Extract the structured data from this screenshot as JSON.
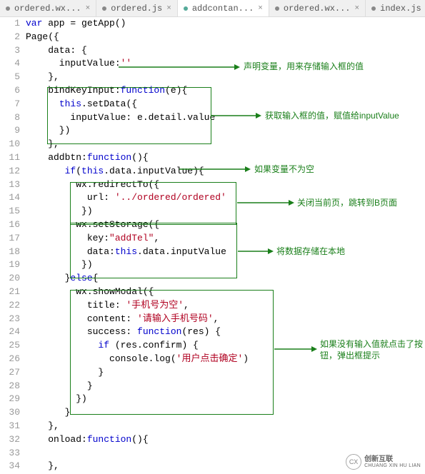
{
  "tabs": [
    {
      "label": "ordered.wx...",
      "active": false
    },
    {
      "label": "ordered.js",
      "active": false
    },
    {
      "label": "addcontan...",
      "active": true
    },
    {
      "label": "ordered.wx...",
      "active": false
    },
    {
      "label": "index.js",
      "active": false
    }
  ],
  "lines": [
    {
      "n": 1,
      "html": "<span class='kw'>var</span> app = getApp()"
    },
    {
      "n": 2,
      "html": "Page({"
    },
    {
      "n": 3,
      "html": "    data: {"
    },
    {
      "n": 4,
      "html": "      inputValue:<span class='str'>''</span>"
    },
    {
      "n": 5,
      "html": "    },"
    },
    {
      "n": 6,
      "html": "    bindKeyInput:<span class='kw'>function</span>(e){"
    },
    {
      "n": 7,
      "html": "      <span class='this'>this</span>.setData({"
    },
    {
      "n": 8,
      "html": "        inputValue: e.detail.value"
    },
    {
      "n": 9,
      "html": "      })"
    },
    {
      "n": 10,
      "html": "    },"
    },
    {
      "n": 11,
      "html": "    addbtn:<span class='kw'>function</span>(){"
    },
    {
      "n": 12,
      "html": "       <span class='kw'>if</span>(<span class='this'>this</span>.data.inputValue){"
    },
    {
      "n": 13,
      "html": "         wx.redirectTo({"
    },
    {
      "n": 14,
      "html": "           url: <span class='str'>'../ordered/ordered'</span>"
    },
    {
      "n": 15,
      "html": "          })"
    },
    {
      "n": 16,
      "html": "         wx.setStorage({"
    },
    {
      "n": 17,
      "html": "           key:<span class='str'>\"addTel\"</span>,"
    },
    {
      "n": 18,
      "html": "           data:<span class='this'>this</span>.data.inputValue"
    },
    {
      "n": 19,
      "html": "          })"
    },
    {
      "n": 20,
      "html": "       }<span class='kw'>else</span>{"
    },
    {
      "n": 21,
      "html": "         wx.showModal({"
    },
    {
      "n": 22,
      "html": "           title: <span class='str'>'手机号为空'</span>,"
    },
    {
      "n": 23,
      "html": "           content: <span class='str'>'请输入手机号码'</span>,"
    },
    {
      "n": 24,
      "html": "           success: <span class='kw'>function</span>(res) {"
    },
    {
      "n": 25,
      "html": "             <span class='kw'>if</span> (res.confirm) {"
    },
    {
      "n": 26,
      "html": "               console.log(<span class='str'>'用户点击确定'</span>)"
    },
    {
      "n": 27,
      "html": "             }"
    },
    {
      "n": 28,
      "html": "           }"
    },
    {
      "n": 29,
      "html": "         })"
    },
    {
      "n": 30,
      "html": "       }"
    },
    {
      "n": 31,
      "html": "    },"
    },
    {
      "n": 32,
      "html": "    onload:<span class='kw'>function</span>(){"
    },
    {
      "n": 33,
      "html": ""
    },
    {
      "n": 34,
      "html": "    },"
    }
  ],
  "annotations": [
    {
      "text": "声明变量，用来存储输入框的值"
    },
    {
      "text": "获取输入框的值，赋值给inputValue"
    },
    {
      "text": "如果变量不为空"
    },
    {
      "text": "关闭当前页，跳转到B页面"
    },
    {
      "text": "将数据存储在本地"
    },
    {
      "text": "如果没有输入值就点击了按钮，弹出框提示"
    }
  ],
  "watermark": {
    "name": "创新互联",
    "url": "CHUANG XIN HU LIAN"
  }
}
